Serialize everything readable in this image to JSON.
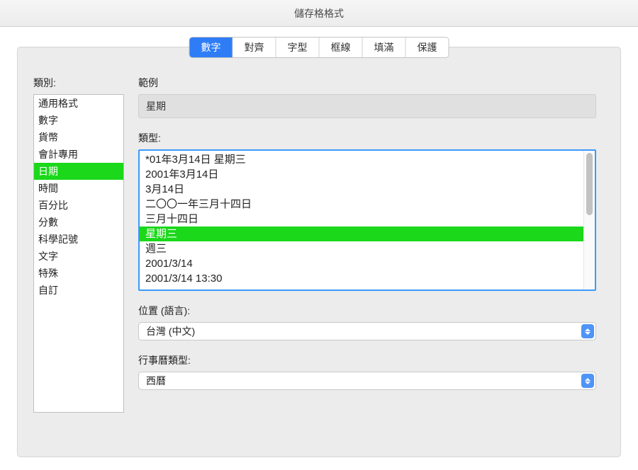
{
  "window_title": "儲存格格式",
  "tabs": [
    "數字",
    "對齊",
    "字型",
    "框線",
    "填滿",
    "保護"
  ],
  "tabs_active_index": 0,
  "category_label": "類別:",
  "categories": [
    "通用格式",
    "數字",
    "貨幣",
    "會計專用",
    "日期",
    "時間",
    "百分比",
    "分數",
    "科學記號",
    "文字",
    "特殊",
    "自訂"
  ],
  "categories_selected_index": 4,
  "sample_label": "範例",
  "sample_value": "星期",
  "type_label": "類型:",
  "type_items": [
    "*01年3月14日 星期三",
    "2001年3月14日",
    "3月14日",
    "二〇〇一年三月十四日",
    "三月十四日",
    "星期三",
    "週三",
    "2001/3/14",
    "2001/3/14 13:30"
  ],
  "type_selected_index": 5,
  "locale_label": "位置 (語言):",
  "locale_value": "台灣 (中文)",
  "calendar_label": "行事曆類型:",
  "calendar_value": "西曆"
}
